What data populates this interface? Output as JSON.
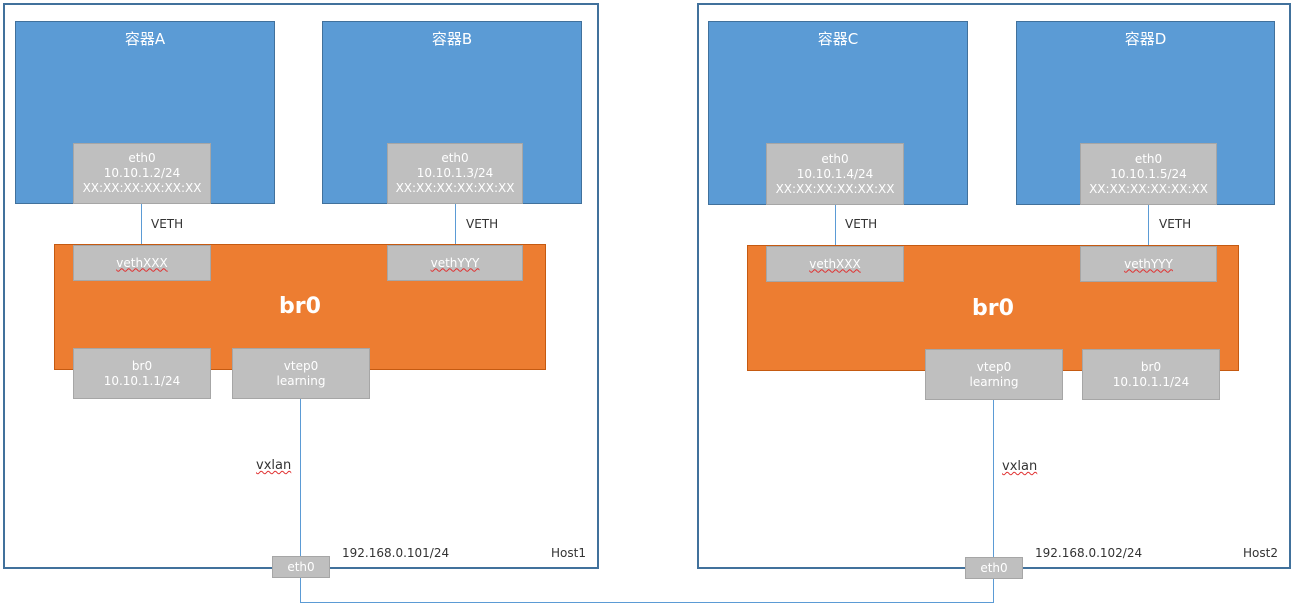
{
  "host1": {
    "name": "Host1",
    "ip": "192.168.0.101/24",
    "container_a": {
      "title": "容器A",
      "eth": [
        "eth0",
        "10.10.1.2/24",
        "XX:XX:XX:XX:XX:XX"
      ]
    },
    "container_b": {
      "title": "容器B",
      "eth": [
        "eth0",
        "10.10.1.3/24",
        "XX:XX:XX:XX:XX:XX"
      ]
    },
    "veth_label_a": "VETH",
    "veth_label_b": "VETH",
    "bridge": {
      "label": "br0",
      "veth_a": "vethXXX",
      "veth_b": "vethYYY",
      "br_port": [
        "br0",
        "10.10.1.1/24"
      ],
      "vtep": [
        "vtep0",
        "learning"
      ]
    },
    "vxlan": "vxlan",
    "eth0": "eth0"
  },
  "host2": {
    "name": "Host2",
    "ip": "192.168.0.102/24",
    "container_c": {
      "title": "容器C",
      "eth": [
        "eth0",
        "10.10.1.4/24",
        "XX:XX:XX:XX:XX:XX"
      ]
    },
    "container_d": {
      "title": "容器D",
      "eth": [
        "eth0",
        "10.10.1.5/24",
        "XX:XX:XX:XX:XX:XX"
      ]
    },
    "veth_label_c": "VETH",
    "veth_label_d": "VETH",
    "bridge": {
      "label": "br0",
      "veth_c": "vethXXX",
      "veth_d": "vethYYY",
      "br_port": [
        "br0",
        "10.10.1.1/24"
      ],
      "vtep": [
        "vtep0",
        "learning"
      ]
    },
    "vxlan": "vxlan",
    "eth0": "eth0"
  },
  "colors": {
    "container": "#5b9bd5",
    "bridge": "#ed7d31",
    "port": "#bfbfbf",
    "host_border": "#41719c",
    "link": "#5b9bd5"
  }
}
